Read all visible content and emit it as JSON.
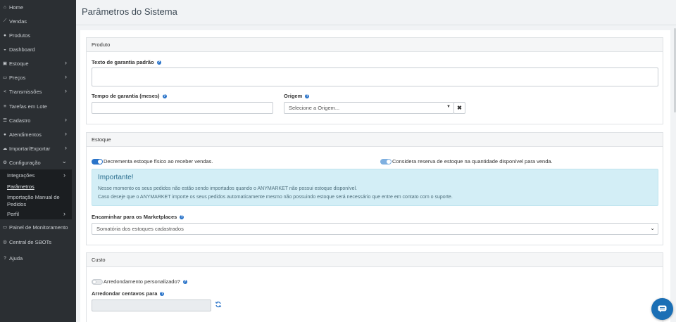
{
  "sidebar": {
    "items": [
      {
        "label": "Home",
        "icon": "home-icon",
        "glyph": "⌂",
        "chevron": false
      },
      {
        "label": "Vendas",
        "icon": "chart-line-icon",
        "glyph": "⟋",
        "chevron": false
      },
      {
        "label": "Produtos",
        "icon": "tag-icon",
        "glyph": "●",
        "chevron": false
      },
      {
        "label": "Dashboard",
        "icon": "dashboard-icon",
        "glyph": "◒",
        "chevron": false
      },
      {
        "label": "Estoque",
        "icon": "cubes-icon",
        "glyph": "▣",
        "chevron": true
      },
      {
        "label": "Preços",
        "icon": "money-icon",
        "glyph": "▭",
        "chevron": true
      },
      {
        "label": "Transmissões",
        "icon": "share-icon",
        "glyph": "<",
        "chevron": true
      },
      {
        "label": "Tarefas em Lote",
        "icon": "list-icon",
        "glyph": "≡",
        "chevron": false
      },
      {
        "label": "Cadastro",
        "icon": "list-ul-icon",
        "glyph": "☰",
        "chevron": true
      },
      {
        "label": "Atendimentos",
        "icon": "comment-icon",
        "glyph": "●",
        "chevron": true
      },
      {
        "label": "Importar/Exportar",
        "icon": "cloud-icon",
        "glyph": "☁",
        "chevron": true
      },
      {
        "label": "Configuração",
        "icon": "gear-icon",
        "glyph": "⚙",
        "chevron": true
      },
      {
        "label": "Painel de Monitoramento",
        "icon": "desktop-icon",
        "glyph": "▭",
        "chevron": false
      },
      {
        "label": "Central de SBOTs",
        "icon": "robot-icon",
        "glyph": "◎",
        "chevron": false
      },
      {
        "label": "Ajuda",
        "icon": "question-icon",
        "glyph": "?",
        "chevron": false
      }
    ],
    "submenu": {
      "integracoes": "Integrações",
      "parametros": "Parâmetros",
      "importacao_line1": "Importação Manual de",
      "importacao_line2": "Pedidos",
      "perfil": "Perfil"
    }
  },
  "page": {
    "title": "Parâmetros do Sistema"
  },
  "produto": {
    "header": "Produto",
    "garantia_texto_label": "Texto de garantia padrão",
    "garantia_tempo_label": "Tempo de garantia (meses)",
    "origem_label": "Origem",
    "origem_placeholder": "Selecione a Origem...",
    "origem_clear": "✖"
  },
  "estoque": {
    "header": "Estoque",
    "toggle1_label": "Decrementa estoque físico ao receber vendas.",
    "toggle2_label": "Considera reserva de estoque na quantidade disponível para venda.",
    "alert_title": "Importante!",
    "alert_line1": "Nesse momento os seus pedidos não estão sendo importados quando o ANYMARKET não possui estoque disponível.",
    "alert_line2": "Caso deseje que o ANYMARKET importe os seus pedidos automaticamente mesmo não possuindo estoque será necessário que entre em contato com o suporte.",
    "encaminhar_label": "Encaminhar para os Marketplaces",
    "encaminhar_value": "Somatória dos estoques cadastrados"
  },
  "custo": {
    "header": "Custo",
    "arredondamento_label": "Arredondamento personalizado?",
    "centavos_label": "Arredondar centavos para"
  },
  "help_glyph": "?",
  "colors": {
    "sidebar_bg": "#2b2f33",
    "toggle_on": "#2a74c9",
    "toggle_disabled": "#7fb0e0",
    "alert_bg": "#d3eef6",
    "chat_button": "#1b6fb5"
  }
}
